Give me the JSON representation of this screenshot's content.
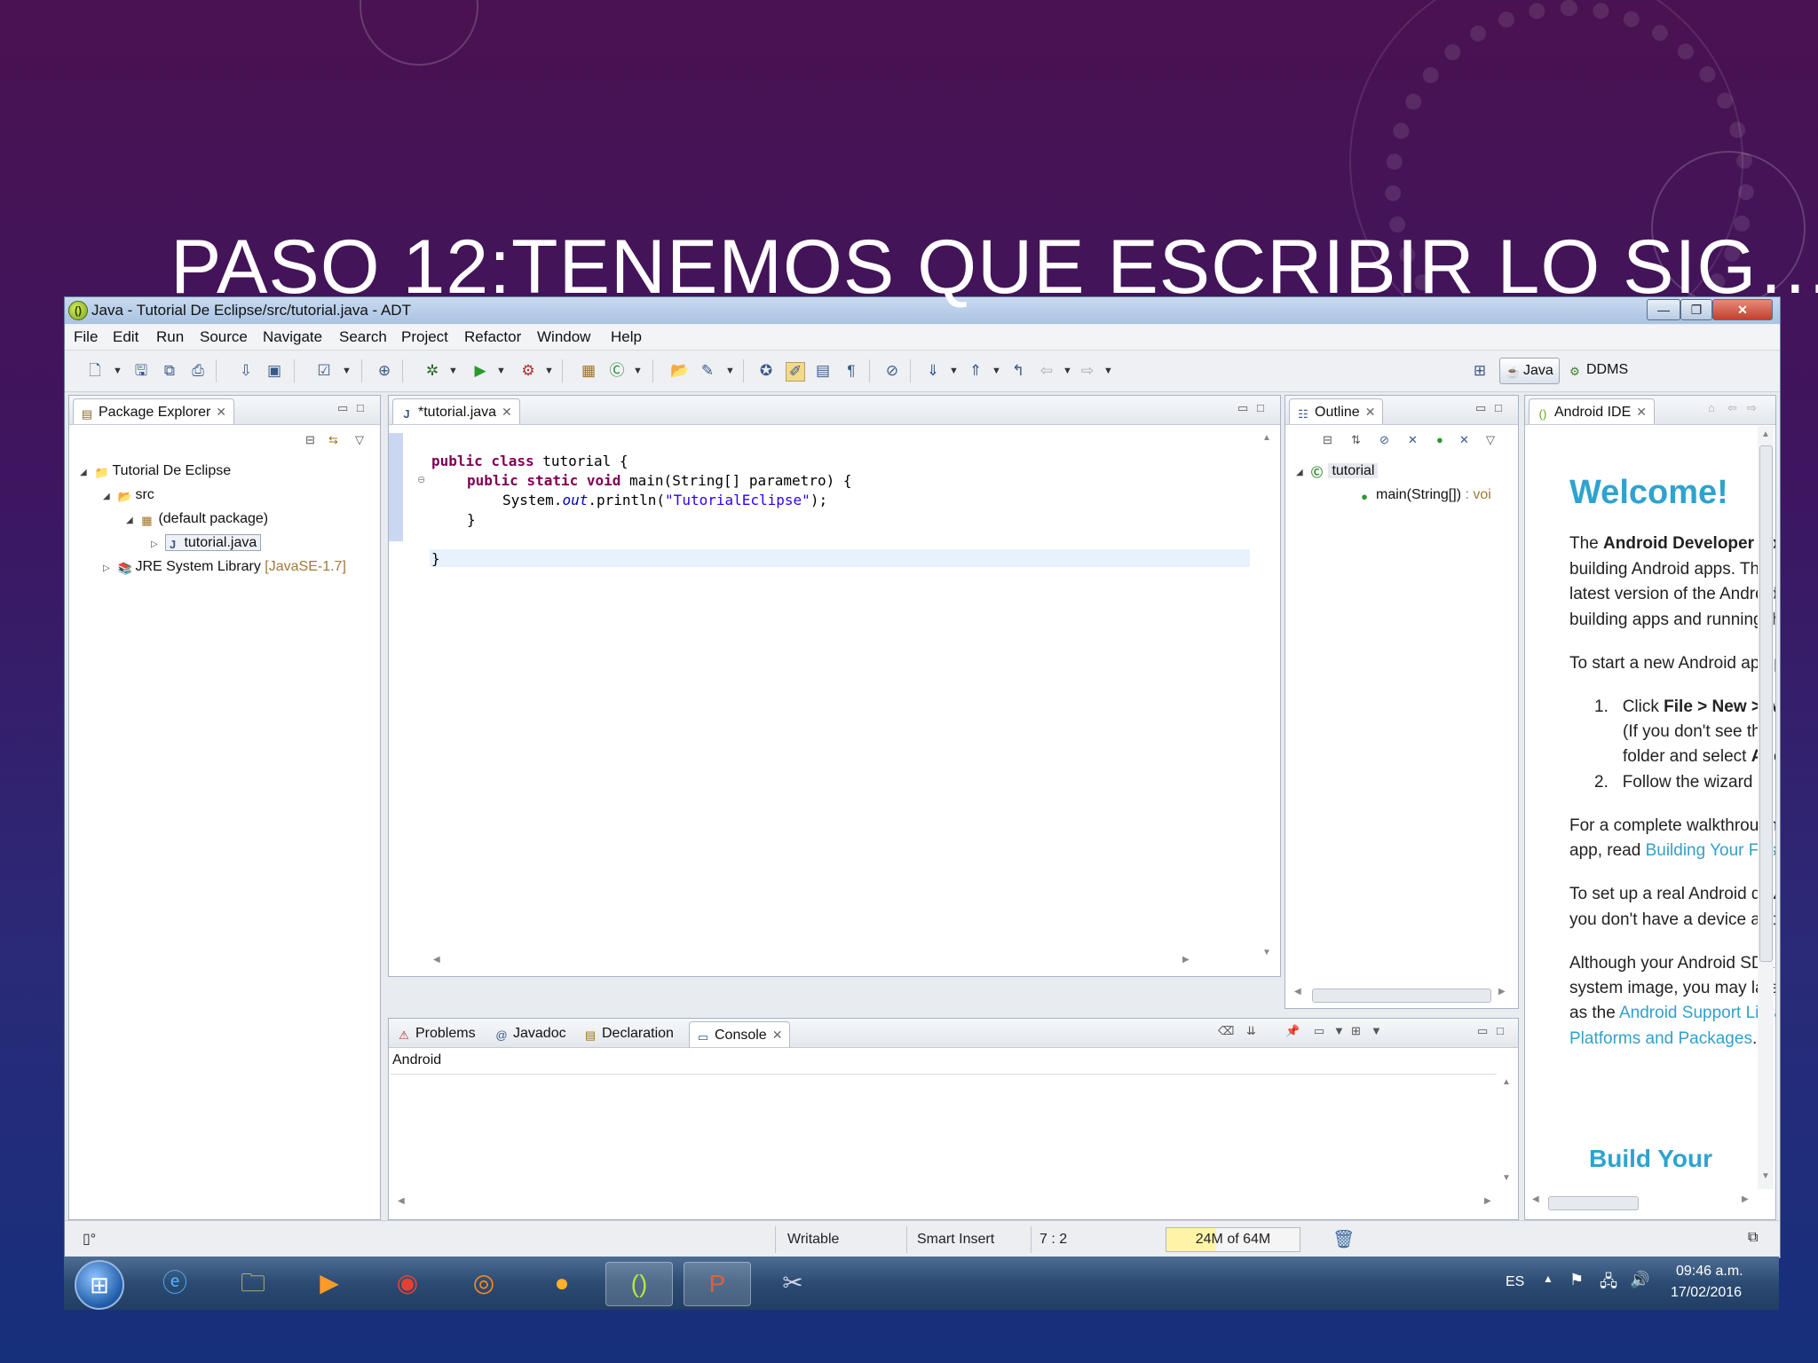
{
  "slide": {
    "title": "PASO 12:TENEMOS QUE ESCRIBIR LO SIG…."
  },
  "window": {
    "title": "Java - Tutorial De Eclipse/src/tutorial.java - ADT",
    "menu": [
      "File",
      "Edit",
      "Run",
      "Source",
      "Navigate",
      "Search",
      "Project",
      "Refactor",
      "Window",
      "Help"
    ],
    "perspectives": {
      "java": "Java",
      "ddms": "DDMS"
    }
  },
  "package_explorer": {
    "tab": "Package Explorer",
    "project": "Tutorial De Eclipse",
    "src": "src",
    "default_package": "(default package)",
    "file": "tutorial.java",
    "jre": "JRE System Library",
    "jre_version": "[JavaSE-1.7]"
  },
  "editor": {
    "tab": "*tutorial.java",
    "line1_kw": "public class",
    "line1_rest": " tutorial {",
    "line2_kw": "public static void",
    "line2_rest": " main(String[] parametro) {",
    "line3_a": "System.",
    "line3_out": "out",
    "line3_b": ".println(",
    "line3_str": "\"TutorialEclipse\"",
    "line3_c": ");",
    "line4": "}",
    "line6": "}"
  },
  "outline": {
    "tab": "Outline",
    "class": "tutorial",
    "method": "main(String[])",
    "method_type": " : voi"
  },
  "android_ide": {
    "tab": "Android IDE",
    "welcome": "Welcome!",
    "p1_a": "The ",
    "p1_b": "Android Developer Tool",
    "p1_l2": "building Android apps. This inte",
    "p1_l3": "latest version of the Android pla",
    "p1_l4": "building apps and running them",
    "p2": "To start a new Android app pro",
    "li1_num": "1.",
    "li1_a": "Click ",
    "li1_b": "File > New > Andr",
    "li1_l2": "(If you don't see this opti",
    "li1_l3_a": "folder and select ",
    "li1_l3_b": "Androi",
    "li2_num": "2.",
    "li2": "Follow the wizard to set u",
    "p3_l1": "For a complete walkthrough tha",
    "p3_l2_a": "app, read ",
    "p3_l2_link": "Building Your First A",
    "p4_l1": "To set up a real Android device",
    "p4_l2": "you don't have a device and ne",
    "p5_l1": "Although your Android SDK alr",
    "p5_l2": "system image, you may later wa",
    "p5_l3_a": "as the ",
    "p5_l3_link": "Android Support Library",
    "p5_l4_link": "Platforms and Packages",
    "p5_l4_end": ".",
    "build": "Build Your"
  },
  "bottom_panel": {
    "tabs": [
      "Problems",
      "Javadoc",
      "Declaration",
      "Console"
    ],
    "console_label": "Android"
  },
  "status": {
    "writable": "Writable",
    "insert": "Smart Insert",
    "position": "7 : 2",
    "heap": "24M of 64M",
    "heap_used_fraction": 0.375
  },
  "taskbar": {
    "lang": "ES",
    "time": "09:46 a.m.",
    "date": "17/02/2016"
  },
  "colors": {
    "keyword": "#7f0055",
    "string": "#2a00ff",
    "link": "#33a0c8",
    "welcome": "#2ea3cf"
  }
}
